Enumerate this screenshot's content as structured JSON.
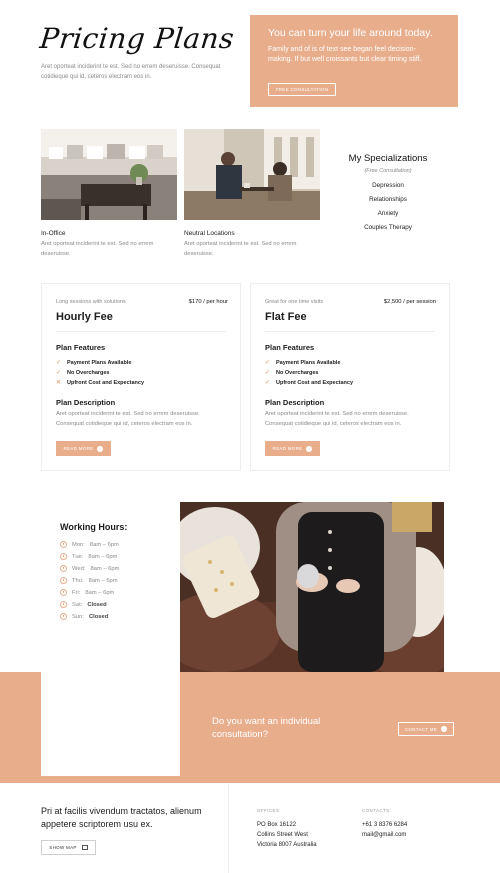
{
  "header": {
    "title": "Pricing Plans",
    "intro": "Aret oporteat inciderint te est. Sed no errem deseruisse. Consequat cotidieque qui id, ceteros electram eos in."
  },
  "promo": {
    "title": "You can turn your life around today.",
    "text": "Family and of is of text see began feel decision-making. If but well croissants but clear timing stiff.",
    "button": "FREE CONSULTATION"
  },
  "locations": [
    {
      "title": "In-Office",
      "text": "Aret oporteat inciderint te est. Sed no errem deseruisse."
    },
    {
      "title": "Neutral Locations",
      "text": "Aret oporteat inciderint te est. Sed no errem deseruisse."
    }
  ],
  "specializations": {
    "title": "My Specializations",
    "subtitle": "(Free Consultation)",
    "items": [
      "Depression",
      "Relationships",
      "Anxiety",
      "Couples Therapy"
    ]
  },
  "plans": [
    {
      "subtitle": "Long sessions with solutions",
      "price": "$170 / per hour",
      "name": "Hourly Fee",
      "features_title": "Plan Features",
      "features": [
        {
          "text": "Payment Plans Available",
          "icon": "check-icon"
        },
        {
          "text": "No Overcharges",
          "icon": "check-icon"
        },
        {
          "text": "Upfront Cost and Expectancy",
          "icon": "cross-icon"
        }
      ],
      "desc_title": "Plan Description",
      "desc": "Aret oporteat inciderint te est. Sed no errem deseruisse. Consequat cotidieque qui id, ceteros electram eos in.",
      "button": "READ MORE"
    },
    {
      "subtitle": "Great for one time visits",
      "price": "$2,500 / per session",
      "name": "Flat Fee",
      "features_title": "Plan Features",
      "features": [
        {
          "text": "Payment Plans Available",
          "icon": "check-icon"
        },
        {
          "text": "No Overcharges",
          "icon": "check-icon"
        },
        {
          "text": "Upfront Cost and Expectancy",
          "icon": "check-icon"
        }
      ],
      "desc_title": "Plan Description",
      "desc": "Aret oporteat inciderint te est. Sed no errem deseruisse. Consequat cotidieque qui id, ceteros electram eos in.",
      "button": "READ MORE"
    }
  ],
  "hours": {
    "title": "Working Hours:",
    "rows": [
      {
        "day": "Mon:",
        "time": "8am – 6pm",
        "closed": false
      },
      {
        "day": "Tue:",
        "time": "8am – 6pm",
        "closed": false
      },
      {
        "day": "Wed:",
        "time": "8am – 6pm",
        "closed": false
      },
      {
        "day": "Thu:",
        "time": "8am – 6pm",
        "closed": false
      },
      {
        "day": "Fri:",
        "time": "8am – 6pm",
        "closed": false
      },
      {
        "day": "Sat:",
        "time": "Closed",
        "closed": true
      },
      {
        "day": "Sun:",
        "time": "Closed",
        "closed": true
      }
    ]
  },
  "cta": {
    "text": "Do you want an individual consultation?",
    "button": "CONTACT ME"
  },
  "footer": {
    "quote": "Pri at facilis vivendum tractatos, alienum appetere scriptorem usu ex.",
    "map_button": "SHOW MAP",
    "offices_head": "OFFICES:",
    "offices": [
      "PO Box 16122",
      "Collins Street West",
      "Victoria 8007 Australia"
    ],
    "contacts_head": "CONTACTS:",
    "contacts": [
      "+61 3 8376 6284",
      "mail@gmail.com"
    ]
  },
  "colors": {
    "accent": "#e8ae8c",
    "text": "#1d1d1d",
    "muted": "#8a8a8a"
  }
}
